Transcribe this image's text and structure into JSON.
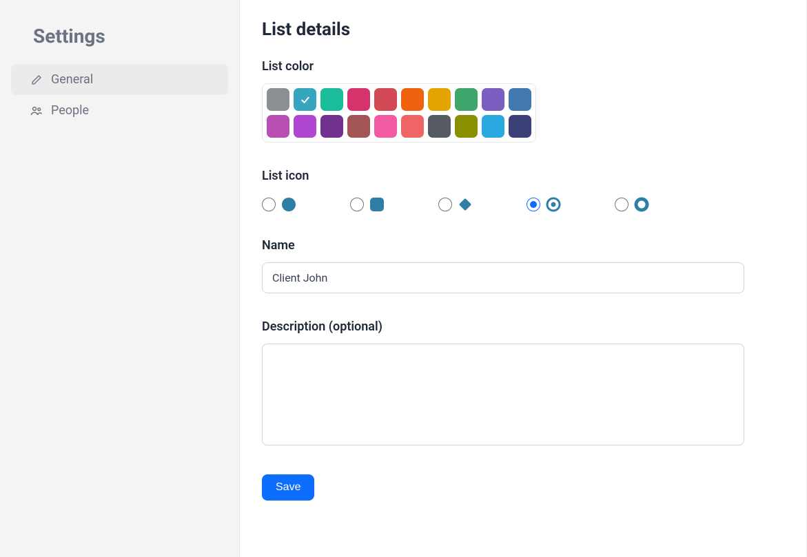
{
  "sidebar": {
    "title": "Settings",
    "items": [
      {
        "label": "General",
        "icon": "pencil-icon",
        "active": true
      },
      {
        "label": "People",
        "icon": "people-icon",
        "active": false
      }
    ]
  },
  "main": {
    "title": "List details",
    "list_color": {
      "label": "List color",
      "selected_index": 1,
      "colors": [
        "#8a8f94",
        "#36a6bf",
        "#1abc9c",
        "#d6336c",
        "#d14a55",
        "#f0630e",
        "#e3a300",
        "#3ea56b",
        "#7a5fc1",
        "#4277b0",
        "#b94fb2",
        "#af47d0",
        "#72308f",
        "#a35555",
        "#f25aa3",
        "#ef6464",
        "#555b60",
        "#8a8f00",
        "#2aa9e0",
        "#3c4078"
      ]
    },
    "list_icon": {
      "label": "List icon",
      "selected_index": 3,
      "preview_color": "#2f7ea6",
      "options": [
        "circle",
        "square",
        "diamond",
        "target",
        "ring"
      ]
    },
    "name": {
      "label": "Name",
      "value": "Client John"
    },
    "description": {
      "label": "Description (optional)",
      "value": ""
    },
    "save_label": "Save"
  }
}
